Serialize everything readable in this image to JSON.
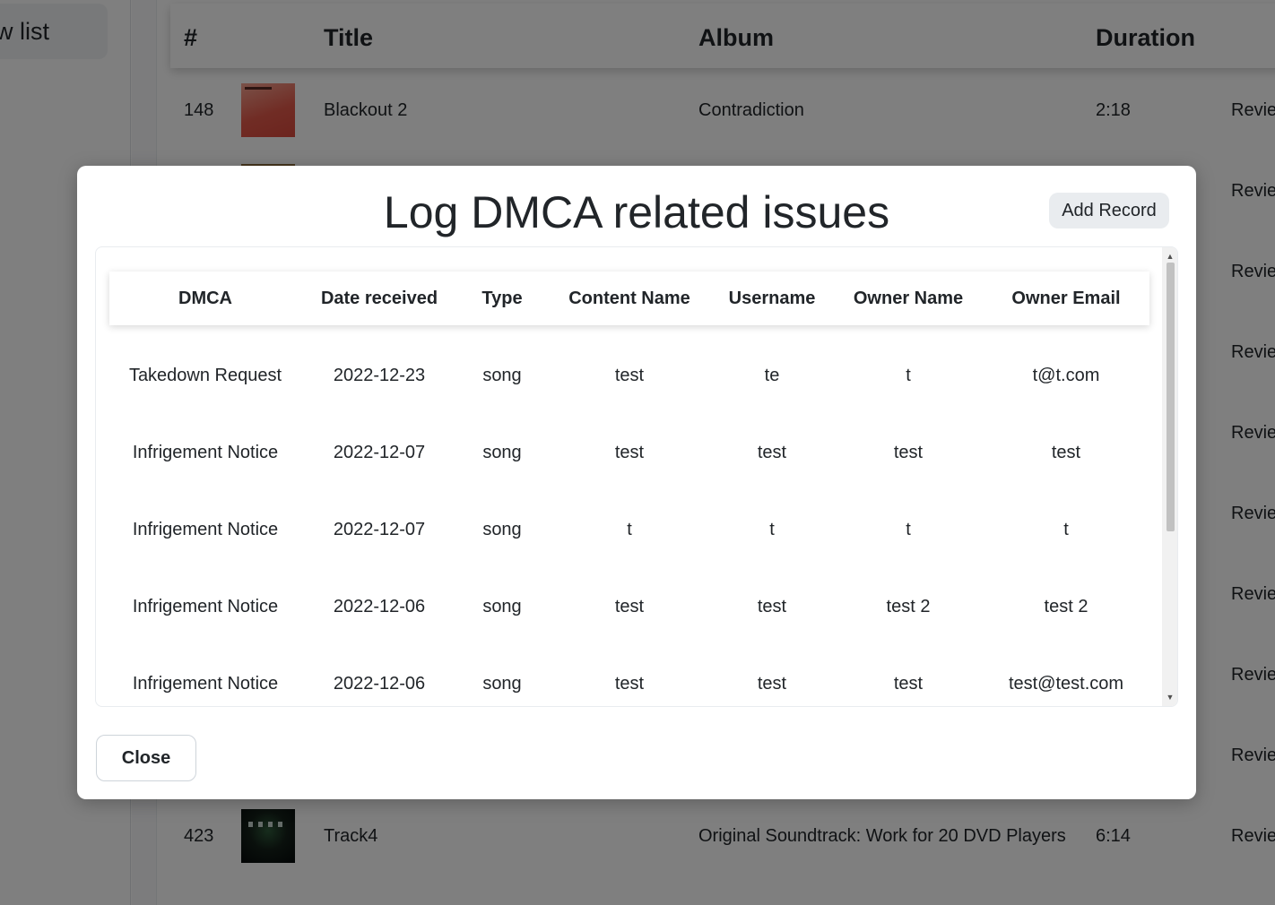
{
  "sidebar": {
    "button_label": "w list"
  },
  "tracks": {
    "headers": {
      "num": "#",
      "title": "Title",
      "album": "Album",
      "duration": "Duration"
    },
    "action_label": "Review",
    "rows": [
      {
        "num": "148",
        "title": "Blackout 2",
        "album": "Contradiction",
        "duration": "2:18",
        "cover": "red-album-cover"
      },
      {
        "num": "423",
        "title": "Track4",
        "album": "Original Soundtrack: Work for 20 DVD Players",
        "duration": "6:14",
        "cover": "dark-album-cover"
      }
    ]
  },
  "modal": {
    "title": "Log DMCA related issues",
    "add_button": "Add Record",
    "close_button": "Close",
    "columns": [
      "DMCA",
      "Date received",
      "Type",
      "Content Name",
      "Username",
      "Owner Name",
      "Owner Email"
    ],
    "rows": [
      [
        "Takedown Request",
        "2022-12-23",
        "song",
        "test",
        "te",
        "t",
        "t@t.com"
      ],
      [
        "Infrigement Notice",
        "2022-12-07",
        "song",
        "test",
        "test",
        "test",
        "test"
      ],
      [
        "Infrigement Notice",
        "2022-12-07",
        "song",
        "t",
        "t",
        "t",
        "t"
      ],
      [
        "Infrigement Notice",
        "2022-12-06",
        "song",
        "test",
        "test",
        "test 2",
        "test 2"
      ],
      [
        "Infrigement Notice",
        "2022-12-06",
        "song",
        "test",
        "test",
        "test",
        "test@test.com"
      ]
    ]
  },
  "colors": {
    "overlay": "#000000",
    "modal_bg": "#ffffff",
    "button_gray": "#e9ecef"
  }
}
